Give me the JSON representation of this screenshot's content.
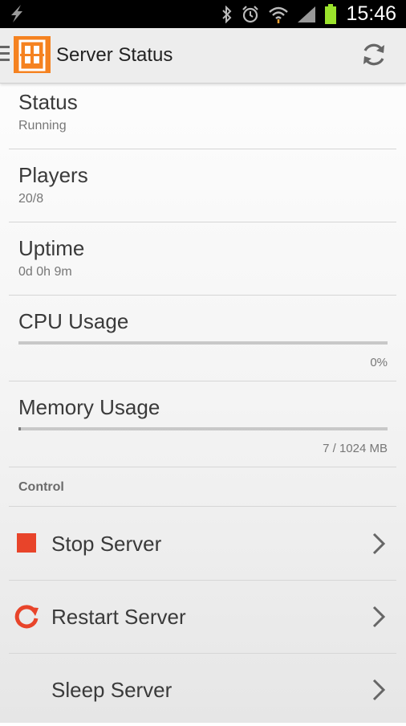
{
  "status_bar": {
    "time": "15:46",
    "icons": [
      "flash-icon",
      "bluetooth-icon",
      "alarm-icon",
      "wifi-icon",
      "signal-icon",
      "battery-icon"
    ]
  },
  "action_bar": {
    "title": "Server Status"
  },
  "stats": {
    "status": {
      "label": "Status",
      "value": "Running"
    },
    "players": {
      "label": "Players",
      "value": "20/8"
    },
    "uptime": {
      "label": "Uptime",
      "value": "0d 0h 9m"
    },
    "cpu": {
      "label": "CPU Usage",
      "value_text": "0%",
      "fraction": 0
    },
    "memory": {
      "label": "Memory Usage",
      "value_text": "7 / 1024 MB",
      "fraction": 0.0068
    }
  },
  "control": {
    "header": "Control",
    "actions": [
      {
        "label": "Stop Server",
        "icon": "stop-icon"
      },
      {
        "label": "Restart Server",
        "icon": "restart-icon"
      },
      {
        "label": "Sleep Server",
        "icon": "sleep-icon"
      }
    ]
  },
  "colors": {
    "accent": "#e8442a",
    "logo": "#f58220"
  }
}
